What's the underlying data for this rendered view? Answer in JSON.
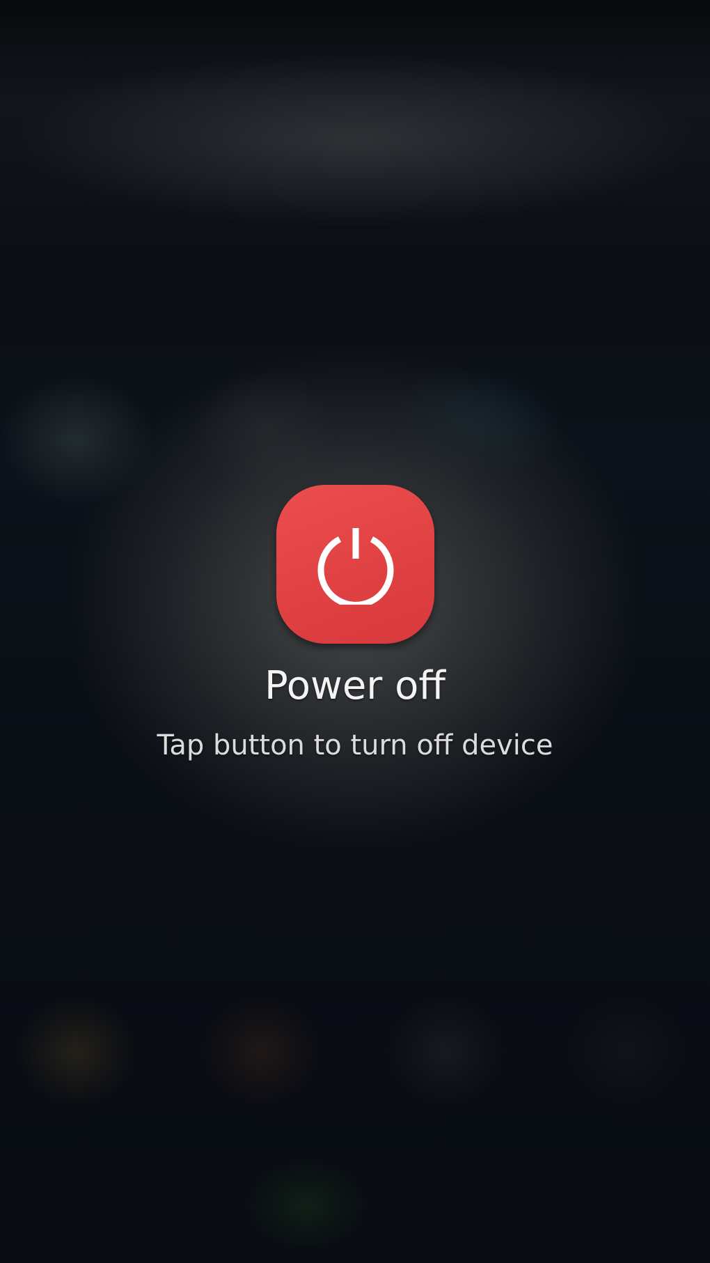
{
  "power_dialog": {
    "title": "Power off",
    "subtitle": "Tap button to turn off device",
    "button_icon": "power-icon",
    "button_color": "#e44446",
    "icon_color": "#ffffff"
  }
}
